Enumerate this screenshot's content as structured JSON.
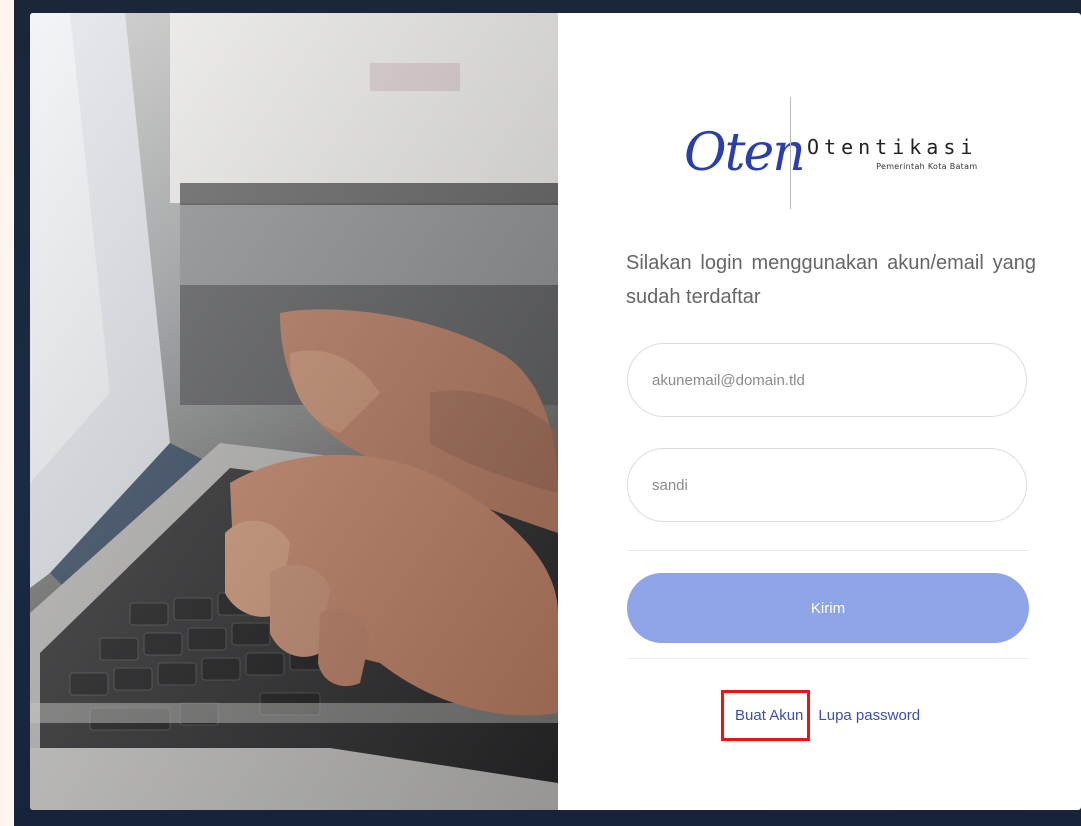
{
  "logo": {
    "mark_text": "Oten",
    "title": "Otentikasi",
    "subtitle": "Pemerintah Kota Batam"
  },
  "login": {
    "instruction": "Silakan login menggunakan akun/email yang sudah terdaftar",
    "email_placeholder": "akunemail@domain.tld",
    "password_placeholder": "sandi",
    "submit_label": "Kirim",
    "create_account_label": "Buat Akun",
    "forgot_password_label": "Lupa password"
  },
  "colors": {
    "brand_blue": "#2c3fa8",
    "submit_button": "#8ea4e6",
    "link": "#3a4fb0",
    "highlight_box": "#e01818"
  }
}
